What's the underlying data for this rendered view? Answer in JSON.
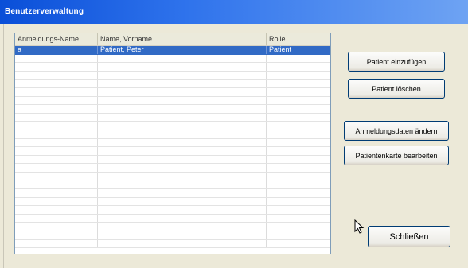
{
  "window": {
    "title": "Benutzerverwaltung"
  },
  "table": {
    "columns": [
      "Anmeldungs-Name",
      "Name, Vorname",
      "Rolle"
    ],
    "rows": [
      {
        "login": "a",
        "name": "Patient, Peter",
        "role": "Patient",
        "selected": true
      }
    ],
    "empty_rows": 23
  },
  "buttons": {
    "add_patient": "Patient einzufügen",
    "delete_patient": "Patient löschen",
    "change_login": "Anmeldungsdaten ändern",
    "edit_patient_card": "Patientenkarte bearbeiten",
    "close": "Schließen"
  },
  "colors": {
    "title_bar": "#0a4fd8",
    "selection": "#316ac5",
    "window_bg": "#ece9d8"
  }
}
